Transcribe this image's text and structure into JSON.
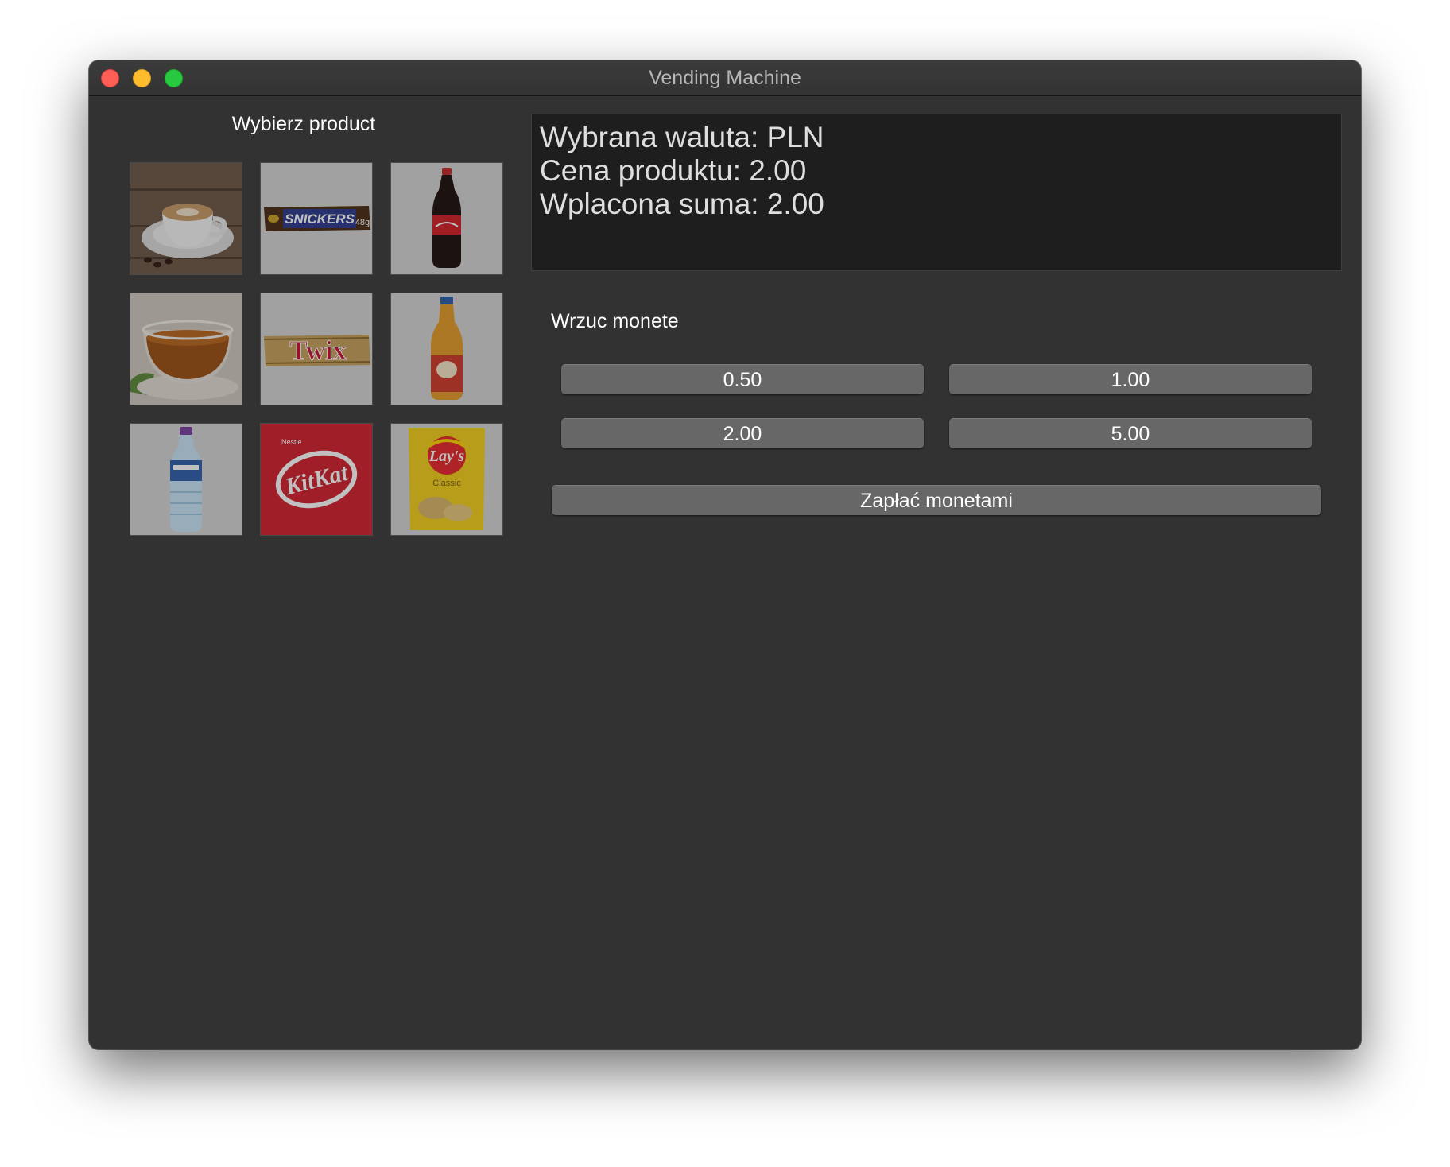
{
  "window": {
    "title": "Vending Machine"
  },
  "products": {
    "heading": "Wybierz product",
    "items": [
      {
        "icon": "coffee-image"
      },
      {
        "icon": "snickers-image",
        "label": "SNICKERS",
        "weight": "48g"
      },
      {
        "icon": "cola-bottle-image"
      },
      {
        "icon": "tea-image"
      },
      {
        "icon": "twix-image",
        "label": "Twix"
      },
      {
        "icon": "juice-bottle-image"
      },
      {
        "icon": "water-bottle-image"
      },
      {
        "icon": "kitkat-image",
        "label": "KitKat",
        "maker": "Nestle"
      },
      {
        "icon": "lays-chips-image",
        "label": "Lay's",
        "flavor": "Classic"
      }
    ]
  },
  "display": {
    "currency_line": "Wybrana waluta: PLN",
    "price_line": "Cena produktu: 2.00",
    "paid_line": "Wplacona suma: 2.00"
  },
  "coins": {
    "heading": "Wrzuc monete",
    "buttons": [
      "0.50",
      "1.00",
      "2.00",
      "5.00"
    ]
  },
  "pay_button": "Zapłać monetami",
  "colors": {
    "window_bg": "#323232",
    "display_bg": "#1e1e1e",
    "button_bg": "#676767",
    "kitkat_red": "#d21f2b",
    "lays_yellow": "#f3cf18"
  }
}
